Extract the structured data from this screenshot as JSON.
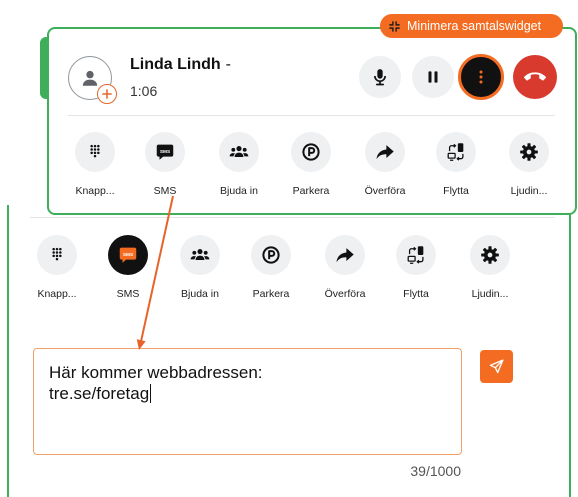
{
  "minimize_badge": {
    "label": "Minimera samtalswidget",
    "icon": "compress-icon"
  },
  "call": {
    "contact_name": "Linda Lindh",
    "name_suffix": "-",
    "duration": "1:06",
    "avatar_icon": "person-icon",
    "add_icon": "plus-icon",
    "controls": {
      "mute_icon": "microphone-icon",
      "hold_icon": "pause-icon",
      "more_icon": "more-vertical-icon",
      "hangup_icon": "phone-hangup-icon"
    }
  },
  "actions": [
    {
      "label": "Knapp...",
      "icon": "keypad-icon"
    },
    {
      "label": "SMS",
      "icon": "sms-icon",
      "icon_text": "SMS"
    },
    {
      "label": "Bjuda in",
      "icon": "group-icon"
    },
    {
      "label": "Parkera",
      "icon": "parking-icon"
    },
    {
      "label": "Överföra",
      "icon": "forward-arrow-icon"
    },
    {
      "label": "Flytta",
      "icon": "move-device-icon"
    },
    {
      "label": "Ljudin...",
      "icon": "gear-icon"
    }
  ],
  "sms_panel": {
    "selected_action_index": 1,
    "message": "Här kommer webbadressen:\ntre.se/foretag",
    "char_count": "39/1000",
    "send_icon": "paper-plane-icon"
  },
  "colors": {
    "accent": "#f36c21",
    "border": "#3fae5b",
    "hangup": "#d83a2e",
    "button_bg": "#eef0f2"
  }
}
